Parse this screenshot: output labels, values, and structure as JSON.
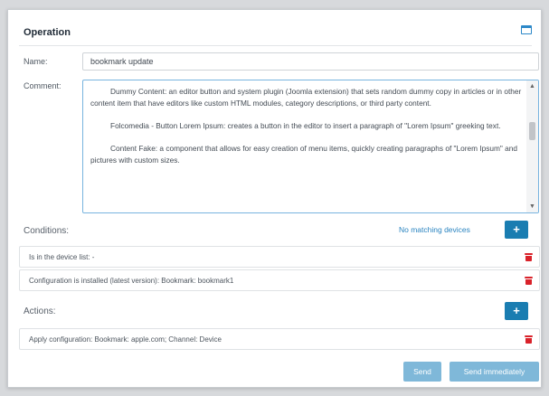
{
  "header": {
    "title": "Operation",
    "window_icon": "window-icon"
  },
  "form": {
    "name_label": "Name:",
    "name_value": "bookmark update",
    "comment_label": "Comment:",
    "comment_paragraphs": [
      "Dummy Content: an editor button and system plugin (Joomla extension) that sets random dummy copy in articles or in other content item that have editors like custom HTML modules, category descriptions, or third party content.",
      "Folcomedia - Button Lorem Ipsum: creates a button in the editor to insert a paragraph of \"Lorem Ipsum\" greeking text.",
      "Content Fake: a component that allows for easy creation of menu items, quickly creating paragraphs of \"Lorem Ipsum\" and pictures with custom sizes."
    ]
  },
  "conditions": {
    "title": "Conditions:",
    "status": "No matching devices",
    "add_label": "+",
    "items": [
      {
        "text": "Is in the device list: -"
      },
      {
        "text": "Configuration is installed (latest version): Bookmark: bookmark1"
      }
    ]
  },
  "actions": {
    "title": "Actions:",
    "add_label": "+",
    "items": [
      {
        "text": "Apply configuration: Bookmark: apple.com; Channel: Device"
      }
    ]
  },
  "footer": {
    "send_label": "Send",
    "send_now_label": "Send immediately"
  },
  "colors": {
    "accent": "#1a7db1",
    "link": "#2a84c0",
    "danger": "#d9222a",
    "disabled_button": "#7fb8d9"
  }
}
